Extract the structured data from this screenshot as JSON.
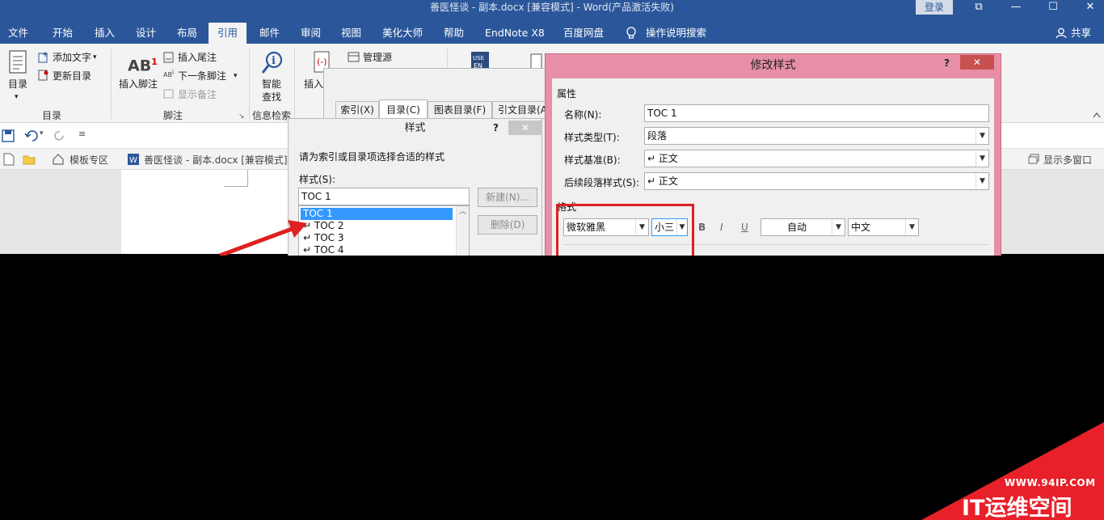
{
  "window": {
    "title": "善医怪谈 - 副本.docx [兼容模式]  -  Word(产品激活失败)",
    "login": "登录",
    "restore_glyph": "⧉",
    "min_glyph": "—",
    "max_glyph": "☐",
    "close_glyph": "✕"
  },
  "tabs": [
    "文件",
    "开始",
    "插入",
    "设计",
    "布局",
    "引用",
    "邮件",
    "审阅",
    "视图",
    "美化大师",
    "帮助",
    "EndNote X8",
    "百度网盘"
  ],
  "active_tab": "引用",
  "search_hint": "操作说明搜索",
  "share": "共享",
  "ribbon": {
    "toc_label": "目录",
    "add_text": "添加文字",
    "update_toc": "更新目录",
    "group_toc": "目录",
    "insert_footnote": "插入脚注",
    "insert_endnote": "插入尾注",
    "next_footnote": "下一条脚注",
    "show_notes": "显示备注",
    "group_footnote": "脚注",
    "smart_lookup_1": "智能",
    "smart_lookup_2": "查找",
    "group_research": "信息检索",
    "insert_citation": "插入",
    "manage_sources": "管理源",
    "ab_label": "AB",
    "footnote_num": "1"
  },
  "doctabs": {
    "template_zone": "模板专区",
    "doc_tab": "善医怪谈 - 副本.docx [兼容模式]",
    "multi_window": "显示多窗口"
  },
  "index_dialog": {
    "tabs": [
      "索引(X)",
      "目录(C)",
      "图表目录(F)",
      "引文目录(A"
    ]
  },
  "style_dialog": {
    "title": "样式",
    "help": "?",
    "close": "✕",
    "prompt": "请为索引或目录项选择合适的样式",
    "styles_label": "样式(S):",
    "current": "TOC 1",
    "items": [
      "TOC 1",
      "↵ TOC 2",
      "↵ TOC 3",
      "↵ TOC 4"
    ],
    "new_btn": "新建(N)...",
    "delete_btn": "删除(D)"
  },
  "modify_dialog": {
    "title": "修改样式",
    "help": "?",
    "close": "✕",
    "section_props": "属性",
    "name_label": "名称(N):",
    "name_value": "TOC 1",
    "type_label": "样式类型(T):",
    "type_value": "段落",
    "based_label": "样式基准(B):",
    "based_value": "↵ 正文",
    "next_label": "后续段落样式(S):",
    "next_value": "↵ 正文",
    "section_format": "格式",
    "font": "微软雅黑",
    "size": "小三",
    "bold": "B",
    "italic": "I",
    "underline": "U",
    "color": "自动",
    "lang": "中文"
  },
  "watermark": {
    "url": "WWW.94IP.COM",
    "brand": "IT运维空间"
  },
  "colors": {
    "accent": "#2b579a",
    "dialog_frame": "#e68fa6",
    "highlight": "#e02020",
    "selection": "#3399ff"
  }
}
